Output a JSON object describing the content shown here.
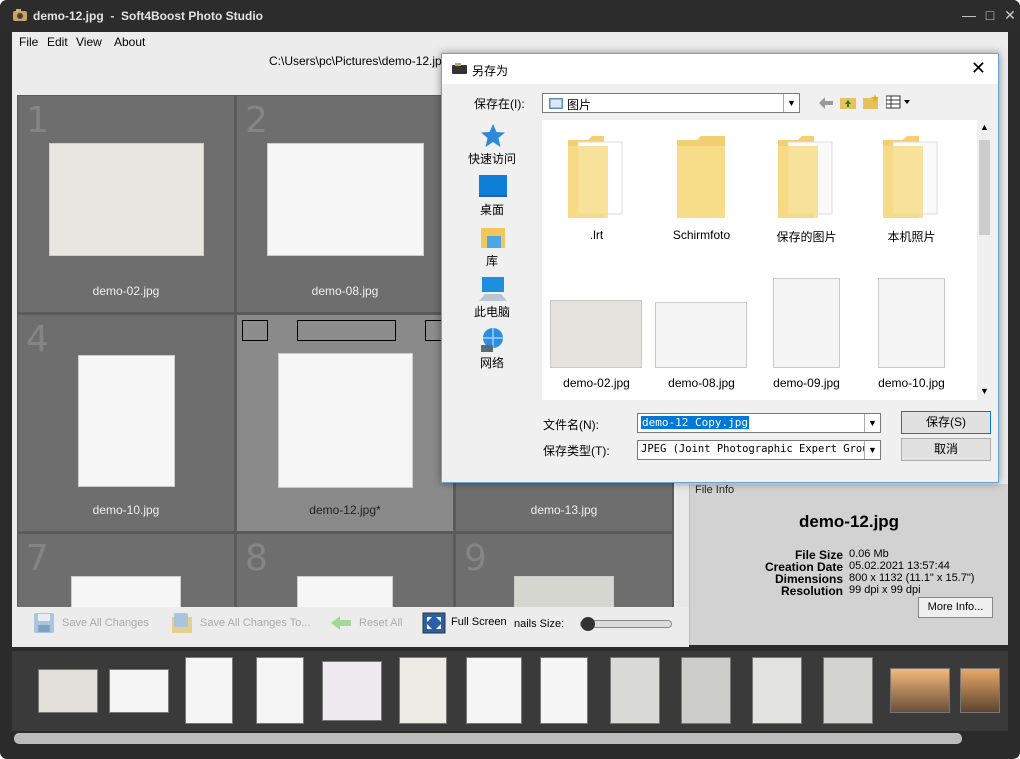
{
  "window": {
    "title": "demo-12.jpg  -  Soft4Boost Photo Studio"
  },
  "menu": {
    "file": "File",
    "edit": "Edit",
    "view": "View",
    "about": "About"
  },
  "path": "C:\\Users\\pc\\Pictures\\demo-12.jpg",
  "grid": {
    "cells": [
      {
        "num": "1",
        "caption": "demo-02.jpg"
      },
      {
        "num": "2",
        "caption": "demo-08.jpg"
      },
      {
        "num": "4",
        "caption": "demo-10.jpg"
      },
      {
        "num": "",
        "caption": "demo-12.jpg*"
      },
      {
        "num": "",
        "caption": "demo-13.jpg"
      },
      {
        "num": "7",
        "caption": ""
      },
      {
        "num": "8",
        "caption": ""
      },
      {
        "num": "9",
        "caption": ""
      }
    ]
  },
  "bottom": {
    "save_all": "Save All Changes",
    "save_all_to": "Save All Changes To...",
    "reset_all": "Reset All",
    "full_screen": "Full Screen",
    "thumbs_size": "nails Size:"
  },
  "info": {
    "header": "File Info",
    "filename": "demo-12.jpg",
    "rows": [
      {
        "k": "File Size",
        "v": "0.06 Mb"
      },
      {
        "k": "Creation Date",
        "v": "05.02.2021  13:57:44"
      },
      {
        "k": "Dimensions",
        "v": "800 x 1132 (11.1\" x 15.7\")"
      },
      {
        "k": "Resolution",
        "v": "99 dpi x 99 dpi"
      }
    ],
    "more": "More Info..."
  },
  "dialog": {
    "title": "另存为",
    "save_in_label": "保存在(I):",
    "save_in_value": "图片",
    "places": [
      {
        "label": "快速访问",
        "icon": "star-icon"
      },
      {
        "label": "桌面",
        "icon": "desktop-icon"
      },
      {
        "label": "库",
        "icon": "library-icon"
      },
      {
        "label": "此电脑",
        "icon": "computer-icon"
      },
      {
        "label": "网络",
        "icon": "network-icon"
      }
    ],
    "files": [
      {
        "label": ".lrt"
      },
      {
        "label": "Schirmfoto"
      },
      {
        "label": "保存的图片"
      },
      {
        "label": "本机照片"
      },
      {
        "label": "demo-02.jpg"
      },
      {
        "label": "demo-08.jpg"
      },
      {
        "label": "demo-09.jpg"
      },
      {
        "label": "demo-10.jpg"
      }
    ],
    "filename_label": "文件名(N):",
    "filename_value": "demo-12 Copy.jpg",
    "filetype_label": "保存类型(T):",
    "filetype_value": "JPEG (Joint Photographic Expert Group",
    "save": "保存(S)",
    "cancel": "取消"
  }
}
